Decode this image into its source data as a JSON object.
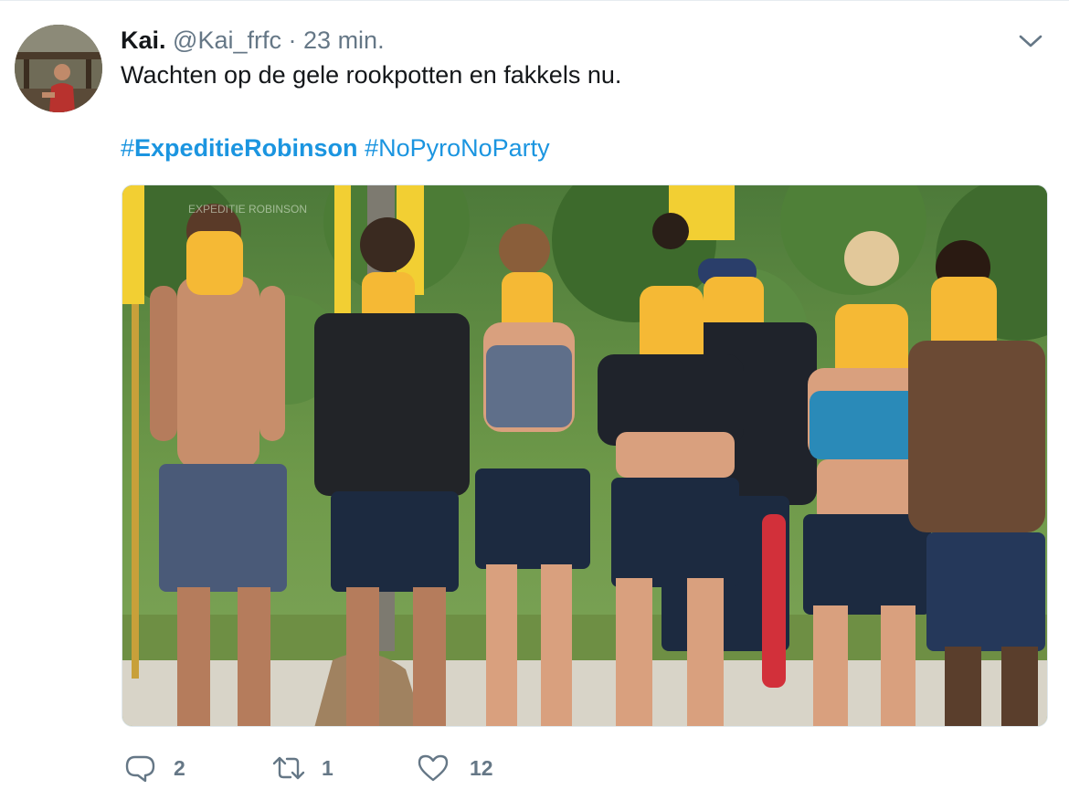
{
  "tweet": {
    "display_name": "Kai.",
    "handle": "@Kai_frfc",
    "separator": "·",
    "time": "23 min.",
    "text": "Wachten op de gele rookpotten en fakkels nu.",
    "hashtags": [
      {
        "prefix": "#",
        "tag": "ExpeditieRobinson"
      },
      {
        "prefix": "#",
        "tag": "NoPyroNoParty"
      }
    ],
    "media_icon": "photo",
    "watermark": "EXPEDITIE ROBINSON",
    "actions": {
      "reply": {
        "icon": "reply-icon",
        "count": "2"
      },
      "retweet": {
        "icon": "retweet-icon",
        "count": "1"
      },
      "like": {
        "icon": "heart-icon",
        "count": "12"
      }
    }
  },
  "colors": {
    "link": "#1b95e0",
    "secondary_text": "#657786",
    "primary_text": "#14171a",
    "mask_yellow": "#f5b935"
  }
}
